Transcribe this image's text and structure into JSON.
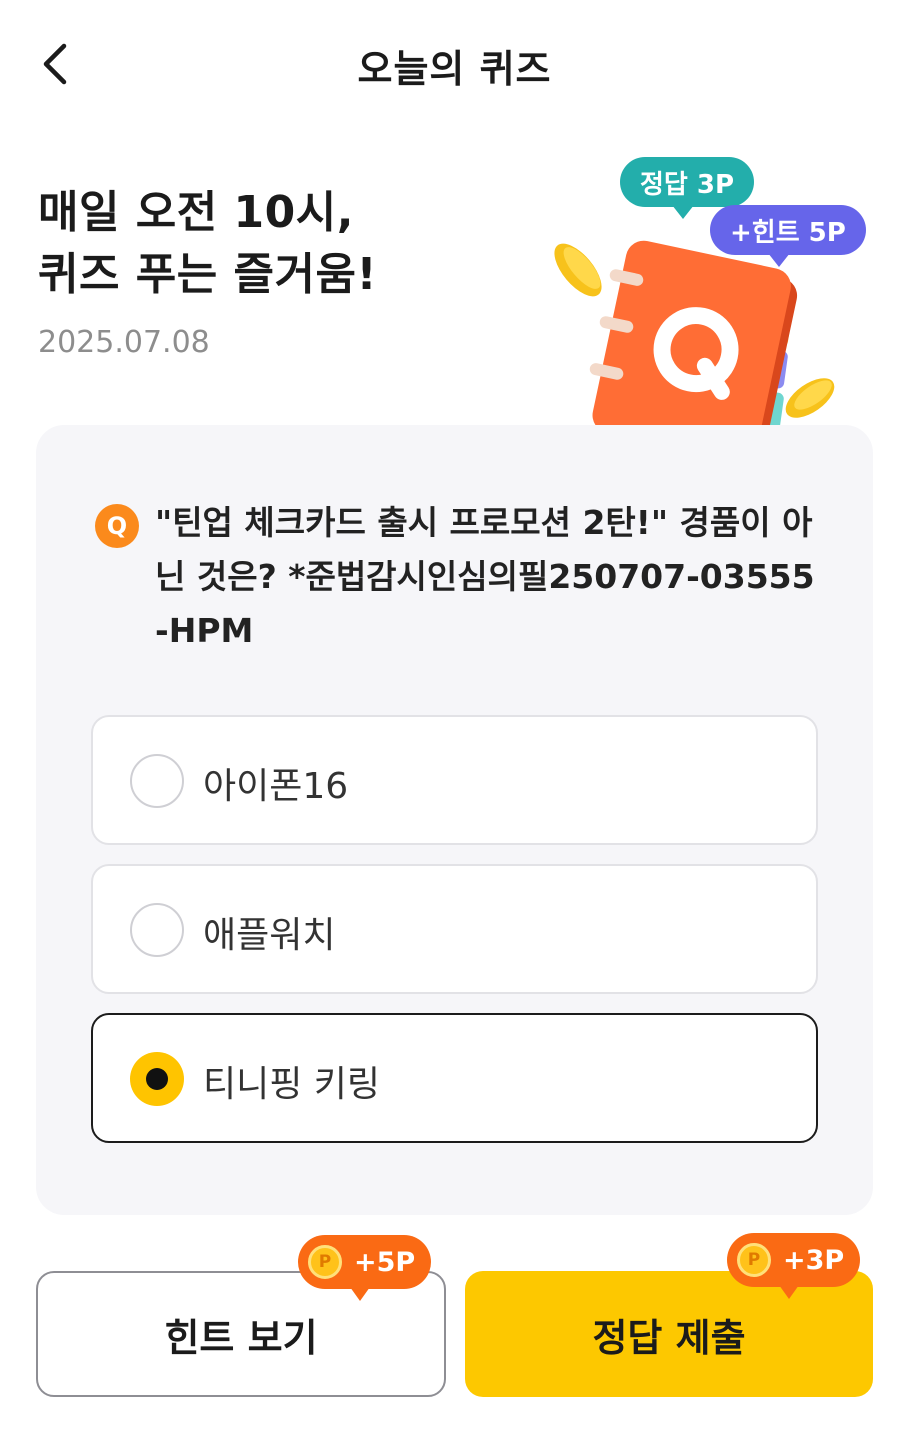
{
  "header": {
    "title": "오늘의 퀴즈",
    "back_icon": "chevron-left-icon"
  },
  "hero": {
    "title_line1": "매일 오전 10시,",
    "title_line2": "퀴즈 푸는 즐거움!",
    "date": "2025.07.08",
    "badge_answer": "정답 3P",
    "badge_hint": "+힌트 5P",
    "illustration_letter": "Q"
  },
  "question": {
    "badge": "Q",
    "text": "\"틴업 체크카드 출시 프로모션 2탄!\" 경품이 아닌 것은? *준법감시인심의필250707-03555-HPM"
  },
  "options": [
    {
      "label": "아이폰16",
      "selected": false
    },
    {
      "label": "애플워치",
      "selected": false
    },
    {
      "label": "티니핑 키링",
      "selected": true
    }
  ],
  "buttons": {
    "hint_label": "힌트 보기",
    "hint_points": "+5P",
    "submit_label": "정답 제출",
    "submit_points": "+3P",
    "coin_letter": "P"
  },
  "colors": {
    "accent_yellow": "#fdc800",
    "point_orange": "#fa6a14",
    "answer_teal": "#23aeab",
    "hint_purple": "#6665ea",
    "card_bg": "#f6f6f9"
  }
}
